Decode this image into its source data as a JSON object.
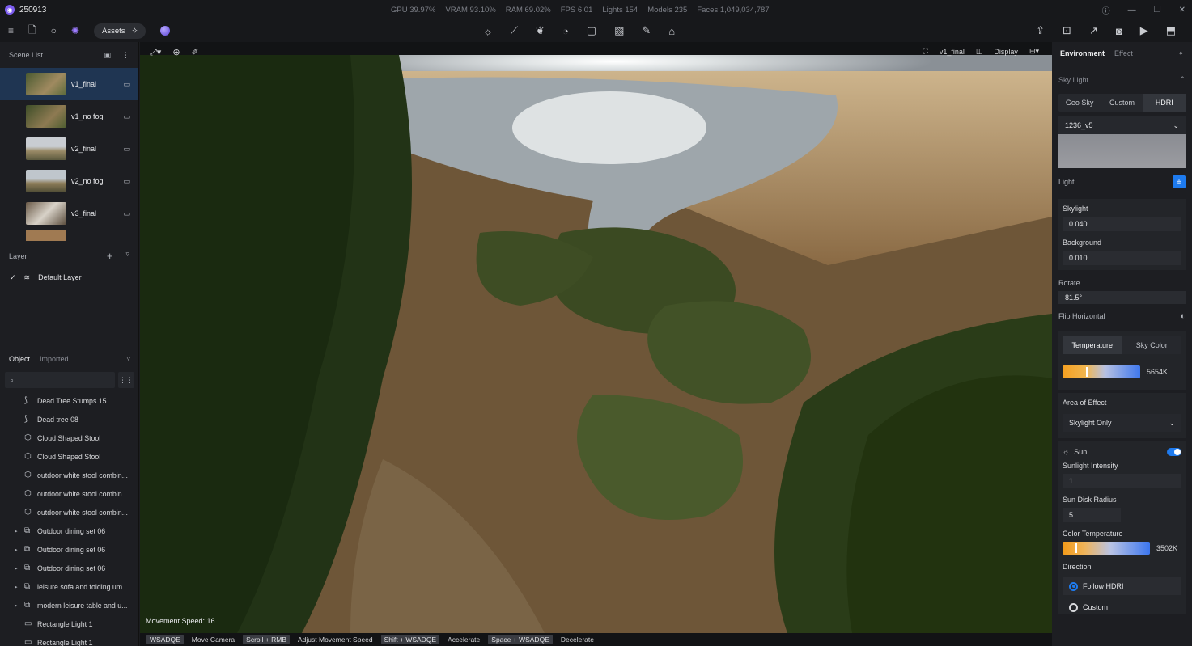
{
  "app": {
    "title": "250913"
  },
  "stats": [
    "GPU 39.97%",
    "VRAM 93.10%",
    "RAM 69.02%",
    "FPS 6.01",
    "Lights 154",
    "Models 235",
    "Faces 1,049,034,787"
  ],
  "toolbar": {
    "assets_label": "Assets"
  },
  "scene_list": {
    "title": "Scene List",
    "items": [
      {
        "label": "v1_final"
      },
      {
        "label": "v1_no fog"
      },
      {
        "label": "v2_final"
      },
      {
        "label": "v2_no fog"
      },
      {
        "label": "v3_final"
      }
    ]
  },
  "layer": {
    "title": "Layer",
    "default_layer": "Default Layer"
  },
  "objects": {
    "tabs": [
      "Object",
      "Imported"
    ],
    "items": [
      {
        "label": "Dead Tree Stumps 15",
        "icon": "branch-icon",
        "expandable": false
      },
      {
        "label": "Dead tree 08",
        "icon": "branch-icon",
        "expandable": false
      },
      {
        "label": "Cloud Shaped Stool",
        "icon": "cube-icon",
        "expandable": false
      },
      {
        "label": "Cloud Shaped Stool",
        "icon": "cube-icon",
        "expandable": false
      },
      {
        "label": "outdoor white stool combin...",
        "icon": "cube-icon",
        "expandable": false
      },
      {
        "label": "outdoor white stool combin...",
        "icon": "cube-icon",
        "expandable": false
      },
      {
        "label": "outdoor white stool combin...",
        "icon": "cube-icon",
        "expandable": false
      },
      {
        "label": "Outdoor dining set 06",
        "icon": "group-icon",
        "expandable": true
      },
      {
        "label": "Outdoor dining set 06",
        "icon": "group-icon",
        "expandable": true
      },
      {
        "label": "Outdoor dining set 06",
        "icon": "group-icon",
        "expandable": true
      },
      {
        "label": "leisure sofa and folding um...",
        "icon": "group-icon",
        "expandable": true
      },
      {
        "label": "modern leisure table and u...",
        "icon": "group-icon",
        "expandable": true
      },
      {
        "label": "Rectangle Light 1",
        "icon": "rect-light-icon",
        "expandable": false
      },
      {
        "label": "Rectangle Light 1",
        "icon": "rect-light-icon",
        "expandable": false
      }
    ]
  },
  "viewport": {
    "camera_name": "v1_final",
    "display_label": "Display",
    "movement_speed": "Movement Speed: 16",
    "hints": [
      {
        "key": "WSADQE",
        "action": "Move Camera"
      },
      {
        "key": "Scroll + RMB",
        "action": "Adjust Movement Speed"
      },
      {
        "key": "Shift + WSADQE",
        "action": "Accelerate"
      },
      {
        "key": "Space + WSADQE",
        "action": "Decelerate"
      }
    ]
  },
  "environment": {
    "tabs": [
      "Environment",
      "Effect"
    ],
    "sky_light_label": "Sky Light",
    "sky_modes": [
      "Geo Sky",
      "Custom",
      "HDRI"
    ],
    "hdri_name": "1236_v5",
    "light_label": "Light",
    "skylight_label": "Skylight",
    "skylight_value": "0.040",
    "background_label": "Background",
    "background_value": "0.010",
    "rotate_label": "Rotate",
    "rotate_value": "81.5°",
    "flip_label": "Flip Horizontal",
    "temp_tabs": [
      "Temperature",
      "Sky Color"
    ],
    "temperature_value": "5654K",
    "temperature_level": 0.3,
    "area_label": "Area of Effect",
    "area_value": "Skylight Only",
    "sun_label": "Sun",
    "sun_intensity_label": "Sunlight Intensity",
    "sun_intensity_value": "1",
    "sun_disk_label": "Sun Disk Radius",
    "sun_disk_value": "5",
    "color_temp_label": "Color Temperature",
    "color_temp_value": "3502K",
    "color_temp_level": 0.15,
    "direction_label": "Direction",
    "direction_options": [
      "Follow HDRI",
      "Custom"
    ]
  },
  "colors": {
    "accent": "#1e7bef",
    "active_row": "#1f3552"
  }
}
